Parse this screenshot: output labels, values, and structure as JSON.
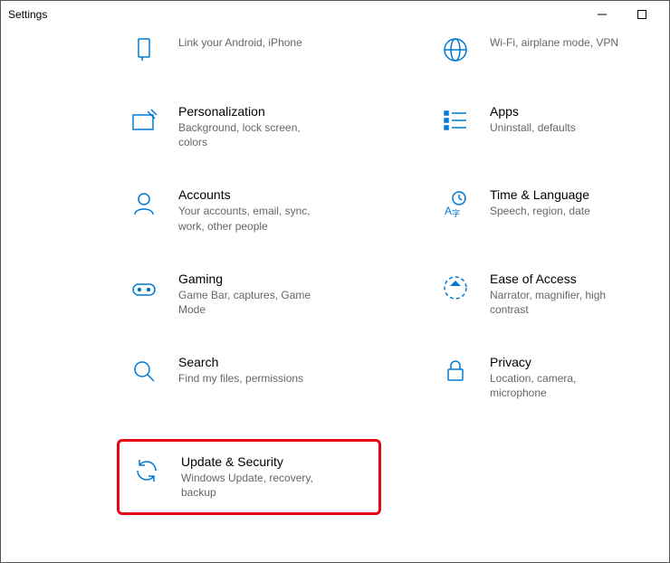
{
  "window": {
    "title": "Settings"
  },
  "categories": [
    {
      "key": "phone",
      "title": "",
      "desc": "Link your Android, iPhone"
    },
    {
      "key": "network",
      "title": "",
      "desc": "Wi-Fi, airplane mode, VPN"
    },
    {
      "key": "personalization",
      "title": "Personalization",
      "desc": "Background, lock screen, colors"
    },
    {
      "key": "apps",
      "title": "Apps",
      "desc": "Uninstall, defaults"
    },
    {
      "key": "accounts",
      "title": "Accounts",
      "desc": "Your accounts, email, sync, work, other people"
    },
    {
      "key": "time",
      "title": "Time & Language",
      "desc": "Speech, region, date"
    },
    {
      "key": "gaming",
      "title": "Gaming",
      "desc": "Game Bar, captures, Game Mode"
    },
    {
      "key": "ease",
      "title": "Ease of Access",
      "desc": "Narrator, magnifier, high contrast"
    },
    {
      "key": "search",
      "title": "Search",
      "desc": "Find my files, permissions"
    },
    {
      "key": "privacy",
      "title": "Privacy",
      "desc": "Location, camera, microphone"
    },
    {
      "key": "update",
      "title": "Update & Security",
      "desc": "Windows Update, recovery, backup"
    }
  ]
}
